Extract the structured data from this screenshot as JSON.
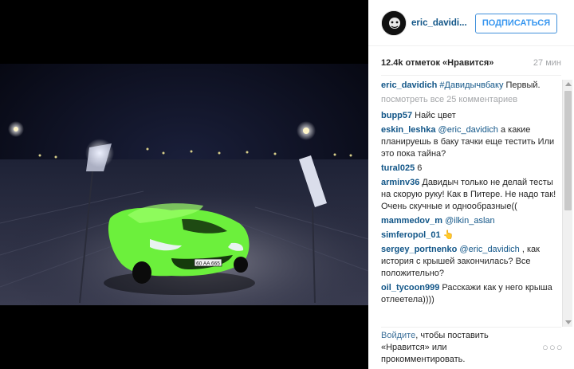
{
  "profile": {
    "username": "eric_davidi...",
    "follow_label": "ПОДПИСАТЬСЯ"
  },
  "post": {
    "likes": "12.4k отметок «Нравится»",
    "time_ago": "27 мин"
  },
  "caption": {
    "user": "eric_davidich",
    "hashtag": "#Давидычвбаку",
    "text": " Первый."
  },
  "view_all": "посмотреть все 25 комментариев",
  "comments": [
    {
      "user": "bupp57",
      "mention": "",
      "text": " Найс цвет"
    },
    {
      "user": "eskin_leshka",
      "mention": " @eric_davidich",
      "text": " а какие планируешь в баку тачки еще тестить Или это пока тайна?"
    },
    {
      "user": "tural025",
      "mention": "",
      "text": " 6"
    },
    {
      "user": "arminv36",
      "mention": "",
      "text": " Давидыч только не делай тесты на скорую руку! Как в Питере. Не надо так! Очень скучные и однообразные(("
    },
    {
      "user": "mammedov_m",
      "mention": " @ilkin_aslan",
      "text": ""
    },
    {
      "user": "simferopol_01",
      "mention": "",
      "text": " 👆"
    },
    {
      "user": "sergey_portnenko",
      "mention": " @eric_davidich",
      "text": " , как история с крышей закончилась? Все положительно?"
    },
    {
      "user": "oil_tycoon999",
      "mention": "",
      "text": " Расскажи как у него крыша отлеетела))))"
    }
  ],
  "footer": {
    "login_link": "Войдите",
    "text": ", чтобы поставить «Нравится» или прокомментировать.",
    "more": "○○○"
  },
  "photo": {
    "plate_text": "60 AA 665",
    "car_color": "#6cf03c"
  }
}
